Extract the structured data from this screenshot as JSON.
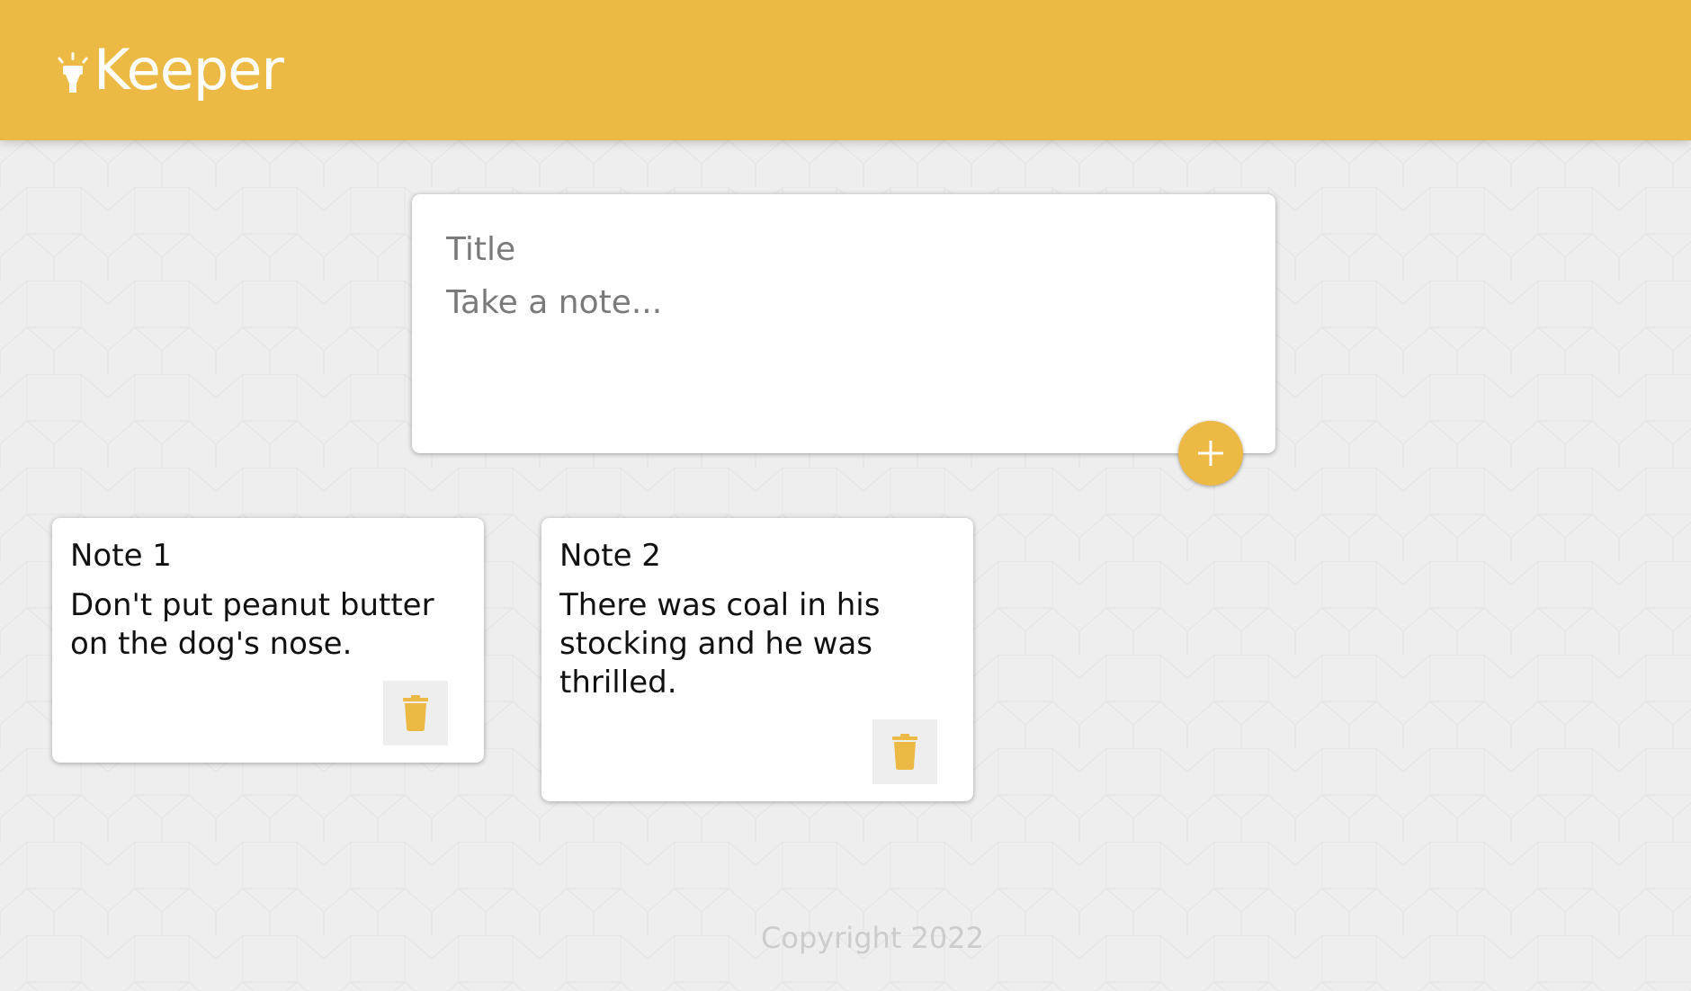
{
  "app": {
    "brand_title": "Keeper",
    "brand_icon": "highlight-icon"
  },
  "composer": {
    "title_placeholder": "Title",
    "content_placeholder": "Take a note...",
    "add_icon": "add-icon",
    "add_button_label": "+"
  },
  "notes": [
    {
      "title": "Note 1",
      "content": "Don't put peanut butter on the dog's nose.",
      "delete_icon": "trash-icon"
    },
    {
      "title": "Note 2",
      "content": "There was coal in his stocking and he was thrilled.",
      "delete_icon": "trash-icon"
    }
  ],
  "footer": {
    "text": "Copyright 2022"
  },
  "colors": {
    "accent": "#ecb944",
    "background": "#eeeeee",
    "card": "#ffffff",
    "footer_text": "#cccccc"
  }
}
